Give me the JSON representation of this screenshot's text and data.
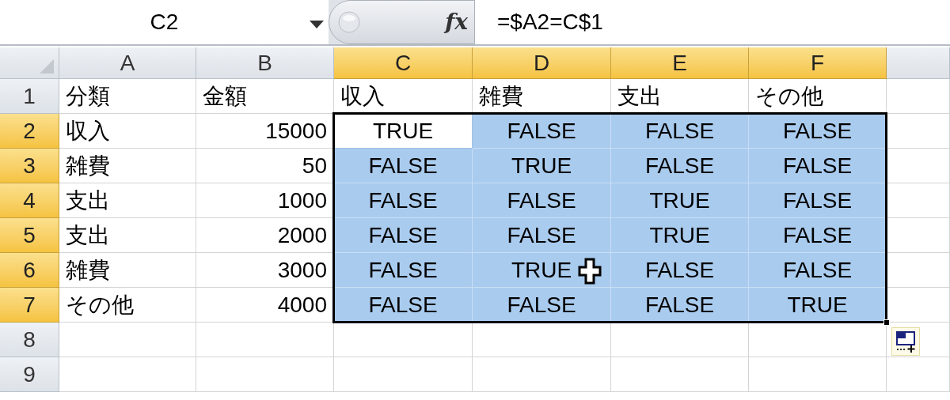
{
  "formula_bar": {
    "name_box": "C2",
    "fx_label": "fx",
    "formula": "=$A2=C$1"
  },
  "columns": [
    {
      "label": "A",
      "selected": false
    },
    {
      "label": "B",
      "selected": false
    },
    {
      "label": "C",
      "selected": true
    },
    {
      "label": "D",
      "selected": true
    },
    {
      "label": "E",
      "selected": true
    },
    {
      "label": "F",
      "selected": true
    },
    {
      "selected": false
    }
  ],
  "rows": [
    {
      "header": "1",
      "selected": false,
      "cells": [
        {
          "text": "分類",
          "kind": "text",
          "selected": false,
          "active": false
        },
        {
          "text": "金額",
          "kind": "text",
          "selected": false,
          "active": false
        },
        {
          "text": "収入",
          "kind": "text",
          "selected": false,
          "active": false
        },
        {
          "text": "雑費",
          "kind": "text",
          "selected": false,
          "active": false
        },
        {
          "text": "支出",
          "kind": "text",
          "selected": false,
          "active": false
        },
        {
          "text": "その他",
          "kind": "text",
          "selected": false,
          "active": false
        }
      ]
    },
    {
      "header": "2",
      "selected": true,
      "cells": [
        {
          "text": "収入",
          "kind": "text",
          "selected": false,
          "active": false
        },
        {
          "text": "15000",
          "kind": "number",
          "selected": false,
          "active": false
        },
        {
          "text": "TRUE",
          "kind": "boolean",
          "selected": true,
          "active": true
        },
        {
          "text": "FALSE",
          "kind": "boolean",
          "selected": true,
          "active": false
        },
        {
          "text": "FALSE",
          "kind": "boolean",
          "selected": true,
          "active": false
        },
        {
          "text": "FALSE",
          "kind": "boolean",
          "selected": true,
          "active": false
        }
      ]
    },
    {
      "header": "3",
      "selected": true,
      "cells": [
        {
          "text": "雑費",
          "kind": "text",
          "selected": false,
          "active": false
        },
        {
          "text": "50",
          "kind": "number",
          "selected": false,
          "active": false
        },
        {
          "text": "FALSE",
          "kind": "boolean",
          "selected": true,
          "active": false
        },
        {
          "text": "TRUE",
          "kind": "boolean",
          "selected": true,
          "active": false
        },
        {
          "text": "FALSE",
          "kind": "boolean",
          "selected": true,
          "active": false
        },
        {
          "text": "FALSE",
          "kind": "boolean",
          "selected": true,
          "active": false
        }
      ]
    },
    {
      "header": "4",
      "selected": true,
      "cells": [
        {
          "text": "支出",
          "kind": "text",
          "selected": false,
          "active": false
        },
        {
          "text": "1000",
          "kind": "number",
          "selected": false,
          "active": false
        },
        {
          "text": "FALSE",
          "kind": "boolean",
          "selected": true,
          "active": false
        },
        {
          "text": "FALSE",
          "kind": "boolean",
          "selected": true,
          "active": false
        },
        {
          "text": "TRUE",
          "kind": "boolean",
          "selected": true,
          "active": false
        },
        {
          "text": "FALSE",
          "kind": "boolean",
          "selected": true,
          "active": false
        }
      ]
    },
    {
      "header": "5",
      "selected": true,
      "cells": [
        {
          "text": "支出",
          "kind": "text",
          "selected": false,
          "active": false
        },
        {
          "text": "2000",
          "kind": "number",
          "selected": false,
          "active": false
        },
        {
          "text": "FALSE",
          "kind": "boolean",
          "selected": true,
          "active": false
        },
        {
          "text": "FALSE",
          "kind": "boolean",
          "selected": true,
          "active": false
        },
        {
          "text": "TRUE",
          "kind": "boolean",
          "selected": true,
          "active": false
        },
        {
          "text": "FALSE",
          "kind": "boolean",
          "selected": true,
          "active": false
        }
      ]
    },
    {
      "header": "6",
      "selected": true,
      "cells": [
        {
          "text": "雑費",
          "kind": "text",
          "selected": false,
          "active": false
        },
        {
          "text": "3000",
          "kind": "number",
          "selected": false,
          "active": false
        },
        {
          "text": "FALSE",
          "kind": "boolean",
          "selected": true,
          "active": false
        },
        {
          "text": "TRUE",
          "kind": "boolean",
          "selected": true,
          "active": false
        },
        {
          "text": "FALSE",
          "kind": "boolean",
          "selected": true,
          "active": false
        },
        {
          "text": "FALSE",
          "kind": "boolean",
          "selected": true,
          "active": false
        }
      ]
    },
    {
      "header": "7",
      "selected": true,
      "cells": [
        {
          "text": "その他",
          "kind": "text",
          "selected": false,
          "active": false
        },
        {
          "text": "4000",
          "kind": "number",
          "selected": false,
          "active": false
        },
        {
          "text": "FALSE",
          "kind": "boolean",
          "selected": true,
          "active": false
        },
        {
          "text": "FALSE",
          "kind": "boolean",
          "selected": true,
          "active": false
        },
        {
          "text": "FALSE",
          "kind": "boolean",
          "selected": true,
          "active": false
        },
        {
          "text": "TRUE",
          "kind": "boolean",
          "selected": true,
          "active": false
        }
      ]
    },
    {
      "header": "8",
      "selected": false
    },
    {
      "header": "9",
      "selected": false
    }
  ]
}
